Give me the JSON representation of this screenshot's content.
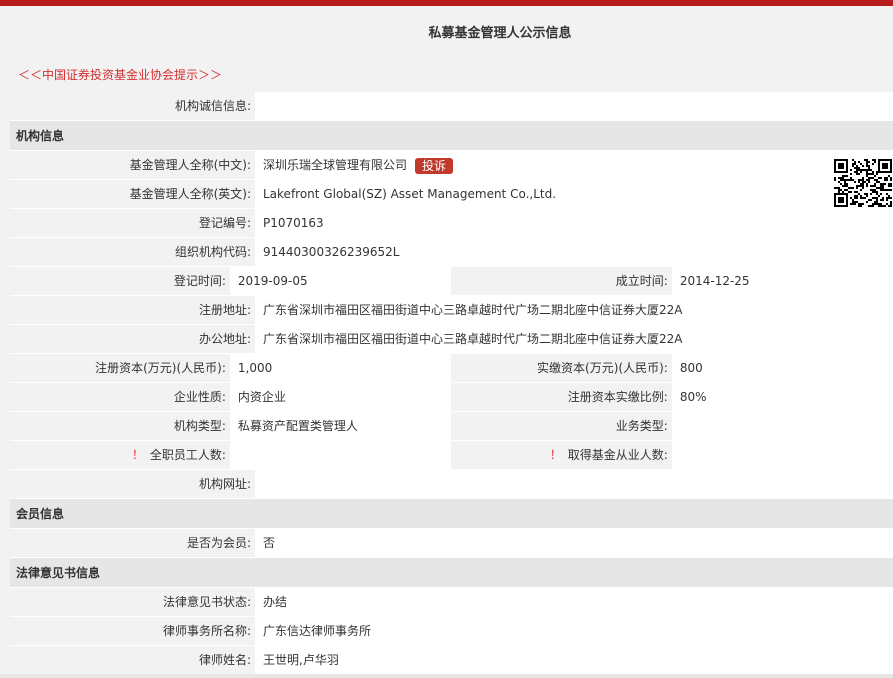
{
  "page": {
    "title": "私募基金管理人公示信息",
    "assoc_link": "＜＜中国证券投资基金业协会提示＞＞"
  },
  "credit": {
    "label": "机构诚信信息:",
    "value": ""
  },
  "sections": {
    "org": "机构信息",
    "member": "会员信息",
    "legal": "法律意见书信息"
  },
  "org": {
    "name_cn_label": "基金管理人全称(中文):",
    "name_cn": "深圳乐瑞全球管理有限公司",
    "complain_label": "投诉",
    "name_en_label": "基金管理人全称(英文):",
    "name_en": "Lakefront Global(SZ) Asset Management Co.,Ltd.",
    "reg_no_label": "登记编号:",
    "reg_no": "P1070163",
    "org_code_label": "组织机构代码:",
    "org_code": "91440300326239652L",
    "reg_time_label": "登记时间:",
    "reg_time": "2019-09-05",
    "est_time_label": "成立时间:",
    "est_time": "2014-12-25",
    "reg_addr_label": "注册地址:",
    "reg_addr": "广东省深圳市福田区福田街道中心三路卓越时代广场二期北座中信证券大厦22A",
    "office_addr_label": "办公地址:",
    "office_addr": "广东省深圳市福田区福田街道中心三路卓越时代广场二期北座中信证券大厦22A",
    "reg_capital_label": "注册资本(万元)(人民币):",
    "reg_capital": "1,000",
    "paid_capital_label": "实缴资本(万元)(人民币):",
    "paid_capital": "800",
    "nature_label": "企业性质:",
    "nature": "内资企业",
    "paid_ratio_label": "注册资本实缴比例:",
    "paid_ratio": "80%",
    "type_label": "机构类型:",
    "type": "私募资产配置类管理人",
    "biz_type_label": "业务类型:",
    "biz_type": "",
    "warn_mark": "！",
    "staff_label": "全职员工人数:",
    "staff": "",
    "qualified_label": "取得基金从业人数:",
    "qualified": "",
    "website_label": "机构网址:",
    "website": ""
  },
  "member": {
    "is_member_label": "是否为会员:",
    "is_member": "否"
  },
  "legal": {
    "status_label": "法律意见书状态:",
    "status": "办结",
    "firm_label": "律师事务所名称:",
    "firm": "广东信达律师事务所",
    "lawyer_label": "律师姓名:",
    "lawyer": "王世明,卢华羽"
  },
  "colors": {
    "accent": "#b71c1c",
    "badge": "#c0392b",
    "warn": "#e53935"
  }
}
